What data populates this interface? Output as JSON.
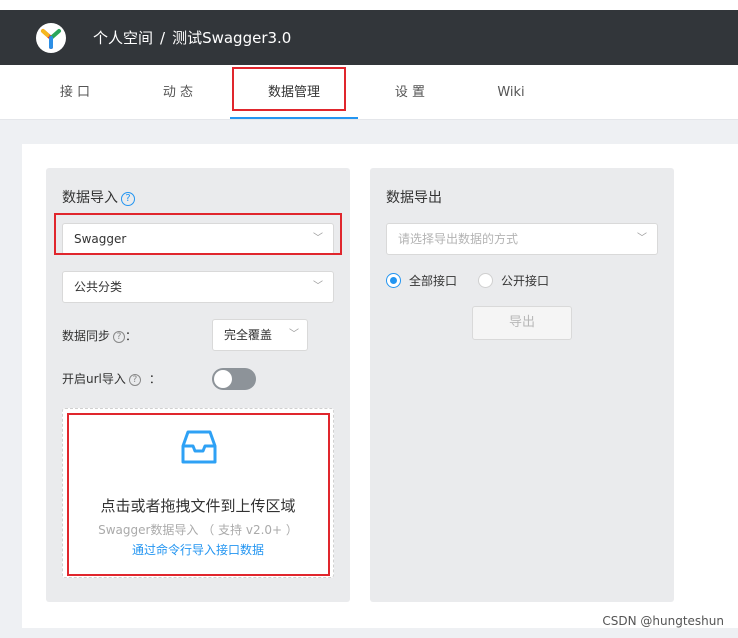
{
  "header": {
    "space": "个人空间",
    "separator": "/",
    "project": "测试Swagger3.0"
  },
  "tabs": [
    {
      "label": "接 口"
    },
    {
      "label": "动 态"
    },
    {
      "label": "数据管理"
    },
    {
      "label": "设 置"
    },
    {
      "label": "Wiki"
    }
  ],
  "import": {
    "title": "数据导入",
    "help": "?",
    "format_select": "Swagger",
    "category_select": "公共分类",
    "sync_label": "数据同步",
    "sync_colon": "：",
    "sync_select": "完全覆盖",
    "url_label": "开启url导入",
    "url_colon": "：",
    "dropzone": {
      "title": "点击或者拖拽文件到上传区域",
      "subtitle": "Swagger数据导入 （ 支持 v2.0+ ）",
      "link": "通过命令行导入接口数据"
    }
  },
  "export": {
    "title": "数据导出",
    "placeholder": "请选择导出数据的方式",
    "radio_all": "全部接口",
    "radio_public": "公开接口",
    "button": "导出"
  },
  "watermark": "CSDN @hungteshun",
  "colors": {
    "accent": "#2395f1",
    "header_bg": "#32363a",
    "highlight": "#e0262d"
  }
}
